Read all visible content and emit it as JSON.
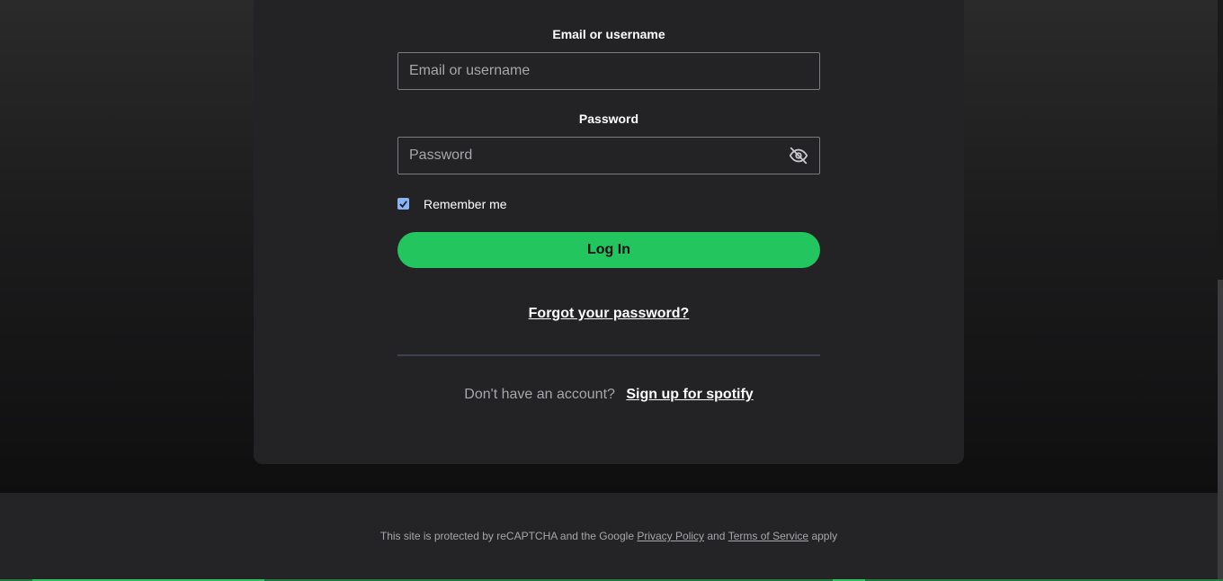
{
  "login": {
    "email_label": "Email or username",
    "email_placeholder": "Email or username",
    "password_label": "Password",
    "password_placeholder": "Password",
    "remember_label": "Remember me",
    "remember_checked": true,
    "login_button": "Log In",
    "forgot_link": "Forgot your password?",
    "signup_question": "Don't have an account?",
    "signup_link": "Sign up for spotify"
  },
  "footer": {
    "text_before": "This site is protected by reCAPTCHA and the Google",
    "privacy_link": "Privacy Policy",
    "and": "and",
    "terms_link": "Terms of Service",
    "text_after": "apply"
  },
  "colors": {
    "accent": "#22c55e",
    "card_bg": "#232325",
    "checkbox": "#8ab4f8"
  },
  "icons": {
    "password_toggle": "eye-off-icon",
    "checkbox": "checkmark-icon"
  }
}
